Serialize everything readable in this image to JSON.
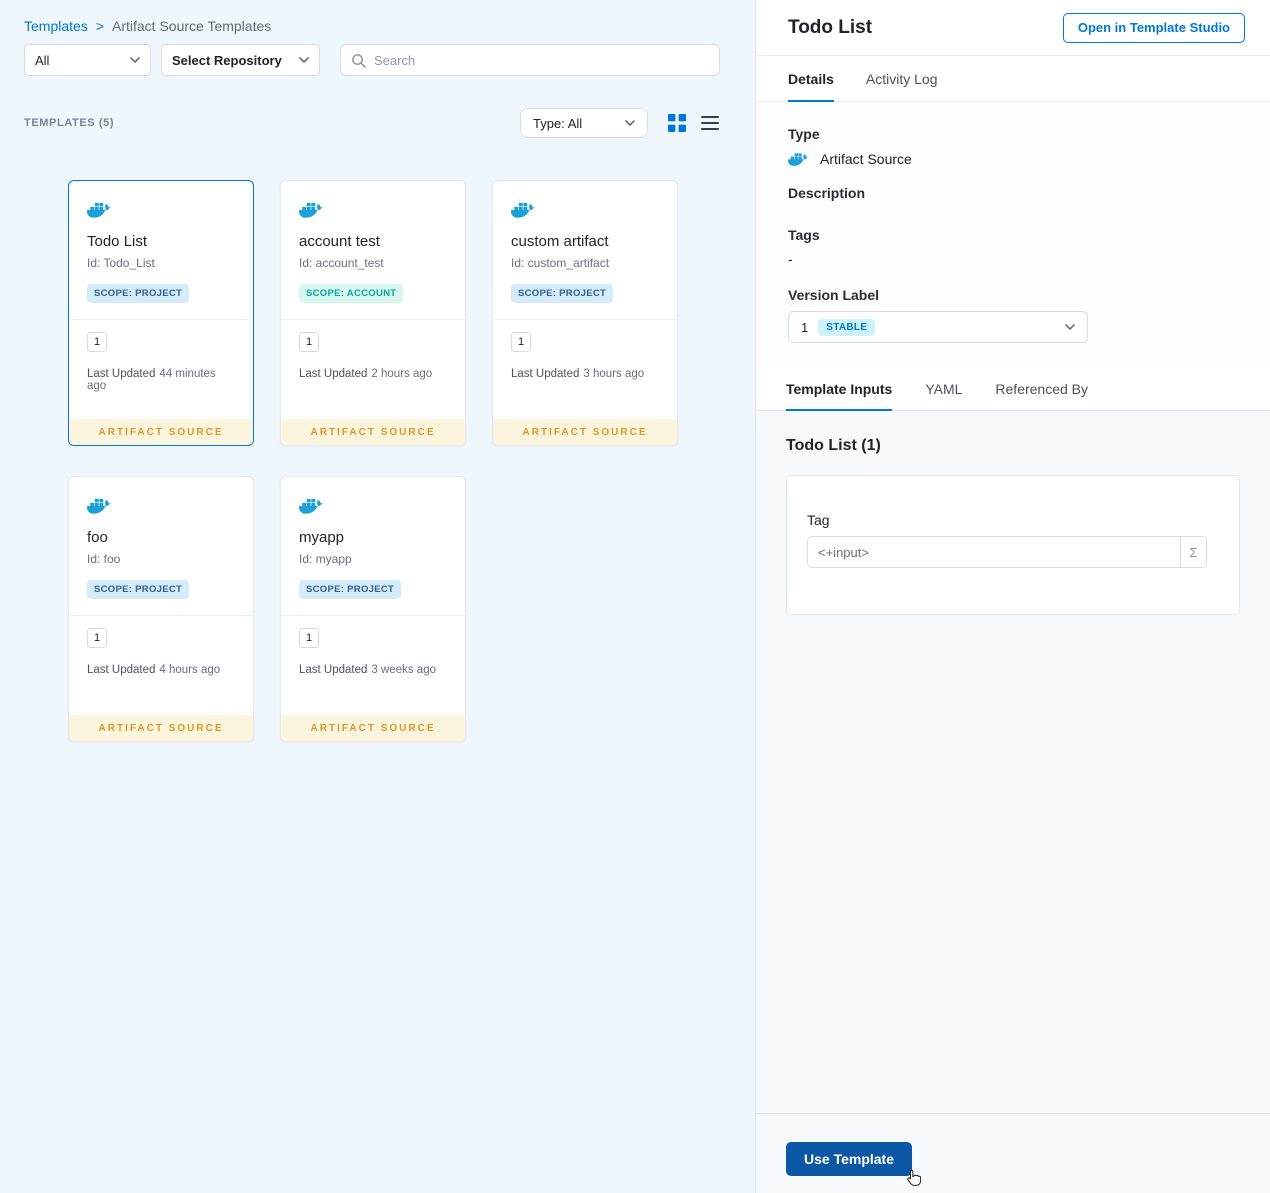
{
  "colors": {
    "primary_blue": "#0278d5",
    "docker_blue": "#1d9fd7",
    "artifact_source_text": "#e09626",
    "artifact_source_bg": "#fcf5de",
    "stable_badge_bg": "#cdf4fe",
    "use_template_bg": "#0d58a6"
  },
  "breadcrumb": {
    "root": "Templates",
    "separator": ">",
    "current": "Artifact Source Templates"
  },
  "filters": {
    "scope": "All",
    "repository": "Select Repository",
    "search_placeholder": "Search"
  },
  "list_header": {
    "count": "TEMPLATES (5)",
    "type_filter": "Type: All"
  },
  "cards": [
    {
      "title": "Todo List",
      "id": "Id: Todo_List",
      "scope": "SCOPE: PROJECT",
      "version": "1",
      "updated_label": "Last Updated",
      "updated": "44 minutes ago",
      "footer": "ARTIFACT SOURCE"
    },
    {
      "title": "account test",
      "id": "Id: account_test",
      "scope": "SCOPE: ACCOUNT",
      "version": "1",
      "updated_label": "Last Updated",
      "updated": "2 hours ago",
      "footer": "ARTIFACT SOURCE"
    },
    {
      "title": "custom artifact",
      "id": "Id: custom_artifact",
      "scope": "SCOPE: PROJECT",
      "version": "1",
      "updated_label": "Last Updated",
      "updated": "3 hours ago",
      "footer": "ARTIFACT SOURCE"
    },
    {
      "title": "foo",
      "id": "Id: foo",
      "scope": "SCOPE: PROJECT",
      "version": "1",
      "updated_label": "Last Updated",
      "updated": "4 hours ago",
      "footer": "ARTIFACT SOURCE"
    },
    {
      "title": "myapp",
      "id": "Id: myapp",
      "scope": "SCOPE: PROJECT",
      "version": "1",
      "updated_label": "Last Updated",
      "updated": "3 weeks ago",
      "footer": "ARTIFACT SOURCE"
    }
  ],
  "panel": {
    "title": "Todo List",
    "open_in_studio": "Open in Template Studio",
    "tabs": {
      "details": "Details",
      "activity_log": "Activity Log"
    },
    "details": {
      "type_label": "Type",
      "type_value": "Artifact Source",
      "description_label": "Description",
      "tags_label": "Tags",
      "tags_value": "-",
      "version_label": "Version Label",
      "version_value": "1",
      "version_badge": "STABLE"
    },
    "inner_tabs": {
      "template_inputs": "Template Inputs",
      "yaml": "YAML",
      "referenced_by": "Referenced By"
    },
    "inputs": {
      "heading": "Todo List (1)",
      "tag_label": "Tag",
      "tag_value": "<+input>",
      "expression_symbol": "Σ"
    },
    "use_template": "Use Template"
  }
}
